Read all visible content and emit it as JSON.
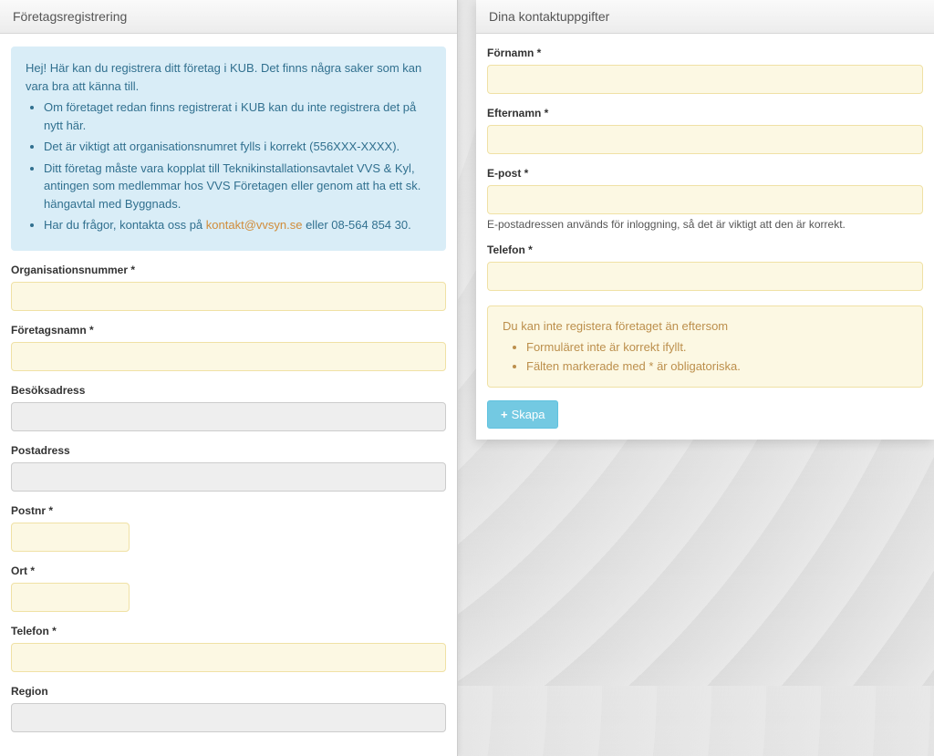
{
  "left": {
    "title": "Företagsregistrering",
    "info": {
      "intro": "Hej! Här kan du registrera ditt företag i KUB. Det finns några saker som kan vara bra att känna till.",
      "points": [
        "Om företaget redan finns registrerat i KUB kan du inte registrera det på nytt här.",
        "Det är viktigt att organisationsnumret fylls i korrekt (556XXX-XXXX).",
        "Ditt företag måste vara kopplat till Teknikinstallationsavtalet VVS & Kyl, antingen som medlemmar hos VVS Företagen eller genom att ha ett sk. hängavtal med Byggnads."
      ],
      "contact_prefix": "Har du frågor, kontakta oss på ",
      "contact_email": "kontakt@vvsyn.se",
      "contact_suffix": " eller 08-564 854 30."
    },
    "fields": {
      "orgnr": "Organisationsnummer *",
      "company": "Företagsnamn *",
      "visit": "Besöksadress",
      "post": "Postadress",
      "zip": "Postnr *",
      "city": "Ort *",
      "phone": "Telefon *",
      "region": "Region"
    }
  },
  "right": {
    "title": "Dina kontaktuppgifter",
    "fields": {
      "firstname": "Förnamn *",
      "lastname": "Efternamn *",
      "email": "E-post *",
      "email_help": "E-postadressen används för inloggning, så det är viktigt att den är korrekt.",
      "phone": "Telefon *"
    },
    "warning": {
      "lead": "Du kan inte registera företaget än eftersom",
      "points": [
        "Formuläret inte är korrekt ifyllt.",
        "Fälten markerade med * är obligatoriska."
      ]
    },
    "button": "Skapa"
  }
}
